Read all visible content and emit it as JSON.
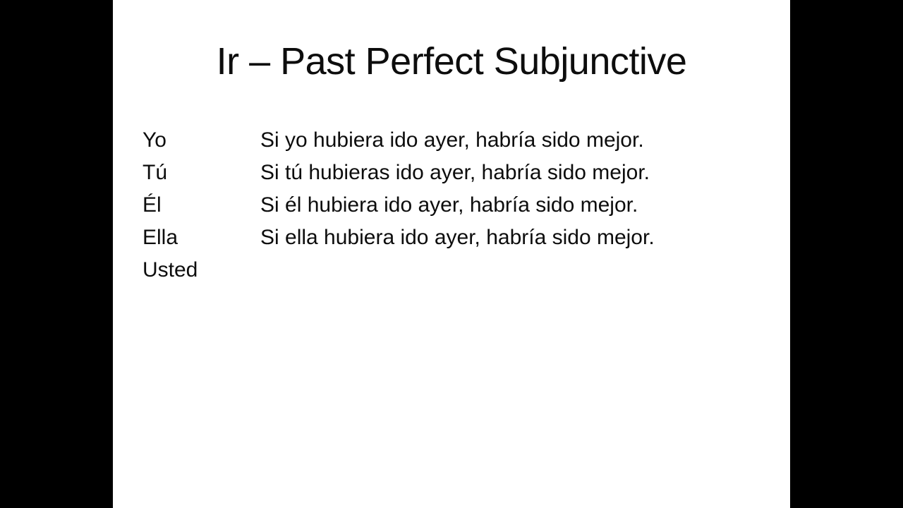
{
  "slide": {
    "title": "Ir – Past Perfect Subjunctive",
    "background_color": "#ffffff",
    "text_color": "#0d0d0d",
    "letterbox_color": "#000000",
    "rows": [
      {
        "pronoun": "Yo",
        "sentence": "Si yo hubiera ido ayer, habría sido mejor."
      },
      {
        "pronoun": "Tú",
        "sentence": "Si tú hubieras ido ayer, habría sido mejor."
      },
      {
        "pronoun": "Él",
        "sentence": "Si él hubiera ido ayer, habría sido mejor."
      },
      {
        "pronoun": "Ella",
        "sentence": "Si ella hubiera ido ayer, habría sido mejor."
      },
      {
        "pronoun": "Usted",
        "sentence": ""
      }
    ]
  }
}
